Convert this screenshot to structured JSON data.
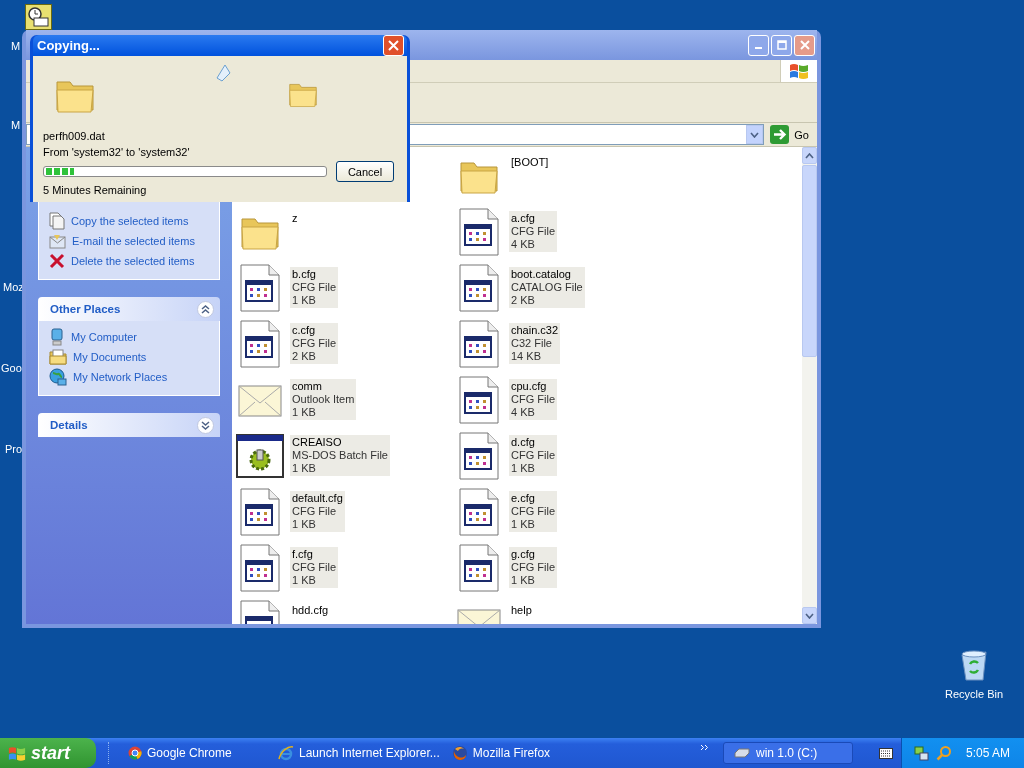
{
  "desktop": {
    "left_labels": [
      "M",
      "M",
      "Moz",
      "Goo",
      "Pro"
    ],
    "recycle_bin": {
      "label": "Recycle Bin"
    }
  },
  "explorer": {
    "address": {
      "go_label": "Go"
    },
    "task_pane": {
      "tasks": [
        {
          "label": "Copy the selected items",
          "kind": "copy"
        },
        {
          "label": "E-mail the selected items",
          "kind": "email"
        },
        {
          "label": "Delete the selected items",
          "kind": "delete"
        }
      ],
      "panels": [
        {
          "title": "Other Places",
          "expanded": true,
          "items": [
            {
              "label": "My Computer",
              "kind": "computer"
            },
            {
              "label": "My Documents",
              "kind": "documents"
            },
            {
              "label": "My Network Places",
              "kind": "network"
            }
          ]
        },
        {
          "title": "Details",
          "expanded": false
        }
      ]
    },
    "files": [
      {
        "name": "[BOOT]",
        "kind": "folder"
      },
      {
        "name": "z",
        "kind": "folder"
      },
      {
        "name": "a.cfg",
        "type": "CFG File",
        "size": "4 KB",
        "kind": "config"
      },
      {
        "name": "b.cfg",
        "type": "CFG File",
        "size": "1 KB",
        "kind": "config"
      },
      {
        "name": "boot.catalog",
        "type": "CATALOG File",
        "size": "2 KB",
        "kind": "config"
      },
      {
        "name": "c.cfg",
        "type": "CFG File",
        "size": "2 KB",
        "kind": "config"
      },
      {
        "name": "chain.c32",
        "type": "C32 File",
        "size": "14 KB",
        "kind": "config"
      },
      {
        "name": "comm",
        "type": "Outlook Item",
        "size": "1 KB",
        "kind": "mail"
      },
      {
        "name": "cpu.cfg",
        "type": "CFG File",
        "size": "4 KB",
        "kind": "config"
      },
      {
        "name": "CREAISO",
        "type": "MS-DOS Batch File",
        "size": "1 KB",
        "kind": "batch"
      },
      {
        "name": "d.cfg",
        "type": "CFG File",
        "size": "1 KB",
        "kind": "config"
      },
      {
        "name": "default.cfg",
        "type": "CFG File",
        "size": "1 KB",
        "kind": "config"
      },
      {
        "name": "e.cfg",
        "type": "CFG File",
        "size": "1 KB",
        "kind": "config"
      },
      {
        "name": "f.cfg",
        "type": "CFG File",
        "size": "1 KB",
        "kind": "config"
      },
      {
        "name": "g.cfg",
        "type": "CFG File",
        "size": "1 KB",
        "kind": "config"
      },
      {
        "name": "hdd.cfg",
        "kind": "config"
      },
      {
        "name": "help",
        "kind": "mail"
      }
    ]
  },
  "copy_dialog": {
    "title": "Copying...",
    "file": "perfh009.dat",
    "route": "From 'system32' to 'system32'",
    "progress": {
      "level": 0.1
    },
    "remaining": "5 Minutes Remaining",
    "cancel": "Cancel"
  },
  "taskbar": {
    "start": "start",
    "quick_launch": [
      {
        "label": "Google Chrome",
        "kind": "chrome"
      },
      {
        "label": "Launch Internet Explorer...",
        "kind": "ie"
      },
      {
        "label": "Mozilla Firefox",
        "kind": "firefox"
      }
    ],
    "windows": [
      {
        "label": "win 1.0 (C:)"
      }
    ],
    "clock": "5:05 AM"
  }
}
